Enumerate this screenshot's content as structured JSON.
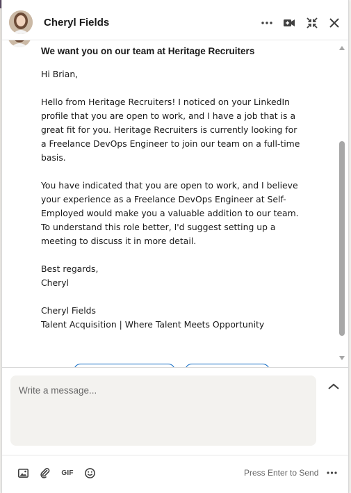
{
  "header": {
    "contact_name": "Cheryl Fields",
    "icons": [
      "more-horizontal-icon",
      "video-call-icon",
      "minimize-icon",
      "close-icon"
    ]
  },
  "message": {
    "subject": "We want you on our team at Heritage Recruiters",
    "greeting": "Hi Brian,",
    "paragraph1_lines": [
      "Hello from Heritage Recruiters! I noticed on your LinkedIn",
      "profile that you are open to work, and I have a job that is a",
      "great fit for you. Heritage Recruiters is currently looking for",
      "a Freelance DevOps Engineer to join our team on a full-time",
      "basis."
    ],
    "paragraph2_lines": [
      "You have indicated that you are open to work, and I believe",
      "your experience as a Freelance DevOps Engineer at Self-",
      "Employed would make you a valuable addition to our team.",
      "To understand this role better, I'd suggest setting up a",
      "meeting to discuss it in more detail."
    ],
    "closing": "Best regards,",
    "closing_name": "Cheryl",
    "signature_name": "Cheryl Fields",
    "signature_title": "Talent Acquisition | Where Talent Meets Opportunity"
  },
  "composer": {
    "placeholder": "Write a message...",
    "value": ""
  },
  "footer": {
    "gif_label": "GIF",
    "send_hint": "Press Enter to Send",
    "icons": [
      "image-icon",
      "attachment-icon",
      "gif-icon",
      "emoji-icon",
      "more-horizontal-icon"
    ]
  },
  "colors": {
    "accent": "#0a66c2",
    "input_bg": "#f3f2ef",
    "text": "#191919",
    "muted": "#666666"
  }
}
